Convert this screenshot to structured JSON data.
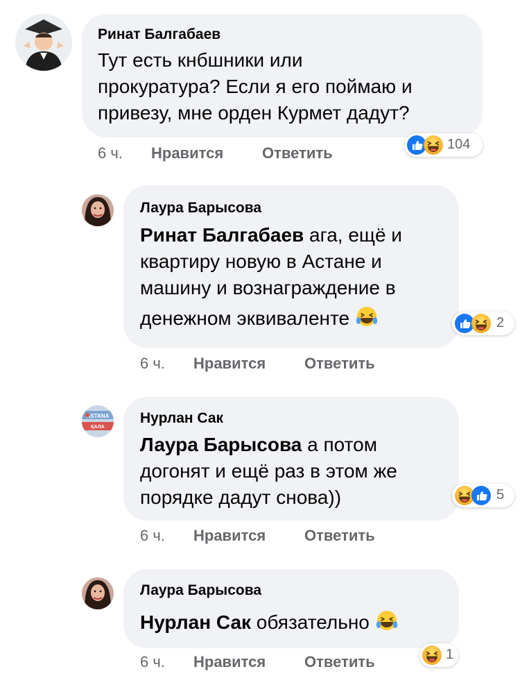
{
  "comments": [
    {
      "author": "Ринат Балгабаев",
      "lines": [
        "Тут есть кнбшники или",
        "прокуратура? Если я его поймаю и",
        "привезу, мне орден Курмет дадут?"
      ],
      "time": "6 ч.",
      "like_label": "Нравится",
      "reply_label": "Ответить",
      "reactions": [
        "like",
        "haha"
      ],
      "reaction_count": "104"
    },
    {
      "author": "Лаура Барысова",
      "mention": "Ринат Балгабаев",
      "lines": [
        " ага, ещё и",
        "квартиру новую в Астане и",
        "машину и вознаграждение в",
        "денежном эквиваленте"
      ],
      "trailing_emoji": "haha",
      "time": "6 ч.",
      "like_label": "Нравится",
      "reply_label": "Ответить",
      "reactions": [
        "like",
        "haha"
      ],
      "reaction_count": "2"
    },
    {
      "author": "Нурлан Сак",
      "mention": "Лаура Барысова",
      "lines": [
        " а потом",
        "догонят и ещё раз в этом же",
        "порядке дадут снова))"
      ],
      "time": "6 ч.",
      "like_label": "Нравится",
      "reply_label": "Ответить",
      "reactions": [
        "haha",
        "like"
      ],
      "reaction_count": "5"
    },
    {
      "author": "Лаура Барысова",
      "mention": "Нурлан Сак",
      "lines": [
        " обязательно"
      ],
      "trailing_emoji": "haha",
      "time": "6 ч.",
      "like_label": "Нравится",
      "reply_label": "Ответить",
      "reactions": [
        "haha"
      ],
      "reaction_count": "1"
    }
  ],
  "avatar_badges": {
    "nurlan_text_top": "ASTANA",
    "nurlan_text_bottom": "ҚАЛА"
  },
  "colors": {
    "bubble": "#f0f2f5",
    "meta": "#65676b",
    "like_blue": "#1877f2",
    "haha_yellow": "#f7b928"
  }
}
